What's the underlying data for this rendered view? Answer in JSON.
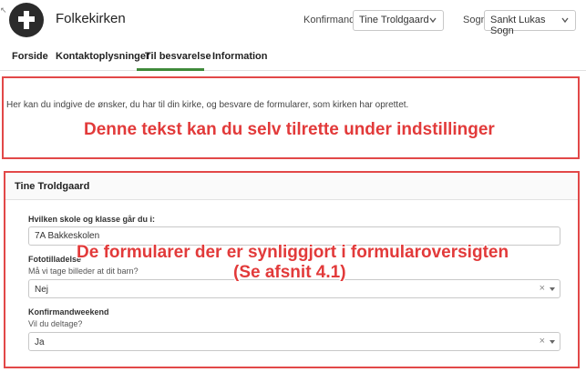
{
  "header": {
    "app_title": "Folkekirken",
    "konfirmand_label": "Konfirmand:",
    "konfirmand_value": "Tine Troldgaard",
    "sogn_label": "Sogn:",
    "sogn_value": "Sankt Lukas Sogn"
  },
  "nav": {
    "items": [
      {
        "label": "Forside"
      },
      {
        "label": "Kontaktoplysninger"
      },
      {
        "label": "Til besvarelse"
      },
      {
        "label": "Information"
      }
    ],
    "active": "Til besvarelse"
  },
  "intro": {
    "text": "Her kan du indgive de ønsker, du har til din kirke, og besvare de formularer, som kirken har oprettet.",
    "annotation": "Denne tekst kan du selv tilrette under indstillinger"
  },
  "form": {
    "title": "Tine Troldgaard",
    "annotation_line1": "De formularer der er synliggjort i formularoversigten",
    "annotation_line2": "(Se afsnit 4.1)",
    "fields": [
      {
        "label": "Hvilken skole og klasse går du i:",
        "value": "7A Bakkeskolen"
      },
      {
        "label": "Fototilladelse",
        "help": "Må vi tage billeder at dit barn?",
        "value": "Nej",
        "clear": "×"
      },
      {
        "label": "Konfirmandweekend",
        "help": "Vil du deltage?",
        "value": "Ja",
        "clear": "×"
      }
    ]
  },
  "colors": {
    "accent": "#3f8a3a",
    "annotation": "#e23a3a"
  }
}
